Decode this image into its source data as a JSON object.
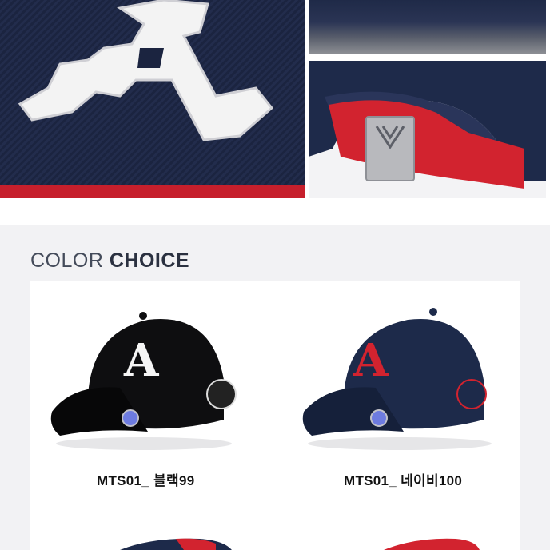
{
  "section": {
    "heading_light": "COLOR",
    "heading_bold": "CHOICE"
  },
  "products": [
    {
      "caption": "MTS01_ 블랙99",
      "color": "#0e0e10",
      "logo_color": "#f5f5f5",
      "logo_letter": "A"
    },
    {
      "caption": "MTS01_ 네이비100",
      "color": "#1d2a4a",
      "logo_color": "#d2232f",
      "logo_letter": "A"
    }
  ],
  "photos": {
    "large_letter": "A",
    "colors": {
      "navy": "#1b2440",
      "red": "#d2232f",
      "white": "#ffffff"
    }
  }
}
